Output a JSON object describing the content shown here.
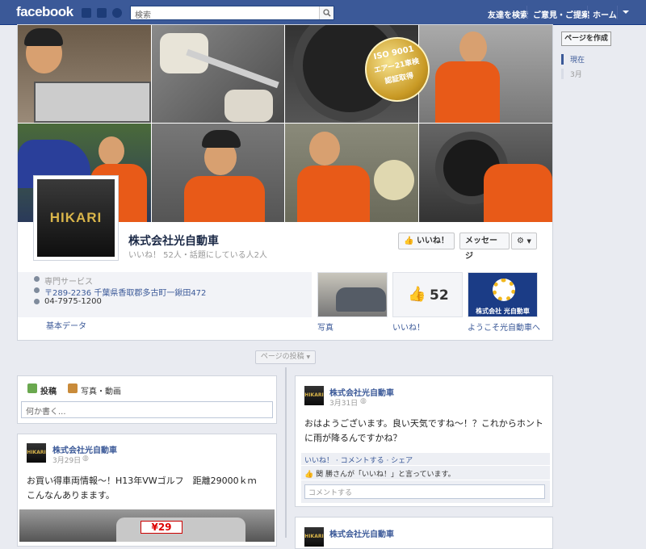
{
  "topbar": {
    "logo": "facebook",
    "search_placeholder": "検索",
    "links": [
      "友達を検索",
      "ご意見・ご提案",
      "ホーム"
    ]
  },
  "cover": {
    "seal_line1": "ISO 9001",
    "seal_line2": "エアー21車検",
    "seal_line3": "認証取得"
  },
  "profile": {
    "avatar_text": "HIKARI",
    "name": "株式会社光自動車",
    "stats": "いいね！ 52人・話題にしている人2人",
    "like_button": "いいね！",
    "message_button": "メッセージ"
  },
  "about": {
    "category": "専門サービス",
    "address": "〒289-2236 千葉県香取郡多古町一鍬田472",
    "phone": "04-7975-1200",
    "basic_data": "基本データ"
  },
  "apps": {
    "photos_label": "写真",
    "likes_label": "いいね！",
    "likes_count": "52",
    "welcome_label": "ようこそ光自動車へ",
    "welcome_image_text": "株式会社 光自動車"
  },
  "timeline": {
    "posts_pill": "ページの投稿"
  },
  "composer": {
    "tab_post": "投稿",
    "tab_photo": "写真・動画",
    "placeholder": "何か書く..."
  },
  "posts": [
    {
      "author": "株式会社光自動車",
      "date": "3月31日",
      "body": "おはようございます。良い天気ですね〜！？これからホントに雨が降るんですかね？",
      "actions": "いいね！ · コメントする · シェア",
      "liked_by": "関 勝さんが「いいね！」と言っています。",
      "comment_placeholder": "コメントする"
    },
    {
      "author": "株式会社光自動車",
      "date": "3月29日",
      "body": "お買い得車両情報〜！H13年VWゴルフ　距離29000ｋｍ　こんなんありまます。",
      "price_tag": "¥29"
    },
    {
      "author": "株式会社光自動車"
    }
  ],
  "sidebar": {
    "create_page": "ページを作成",
    "current": "現在",
    "month": "3月"
  }
}
